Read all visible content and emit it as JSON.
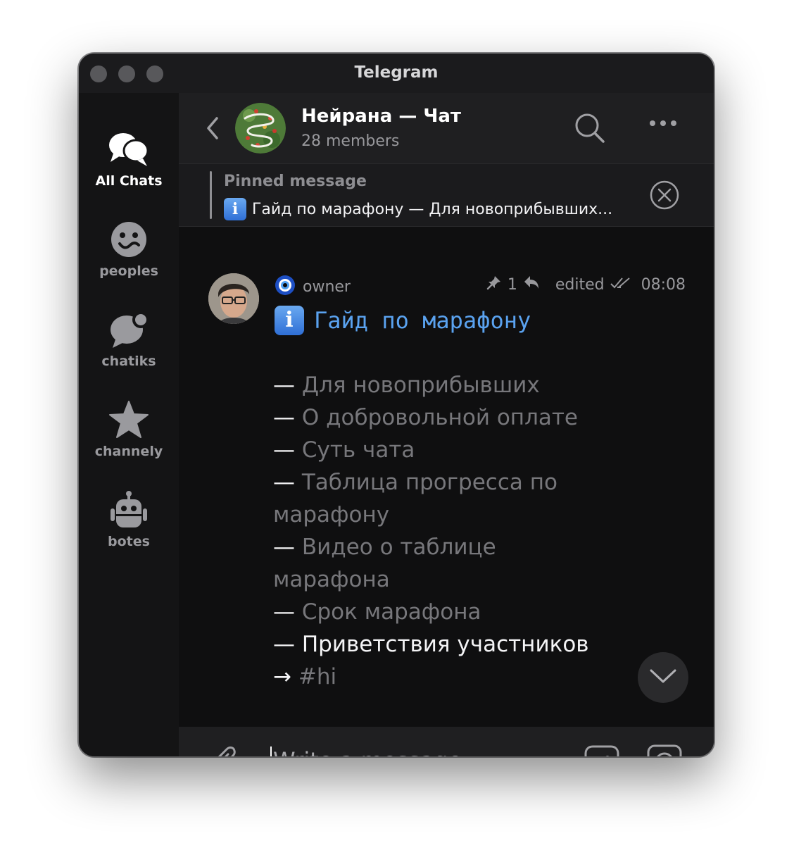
{
  "window": {
    "title": "Telegram"
  },
  "sidebar": {
    "folders": [
      {
        "label": "All Chats",
        "icon": "chat-bubbles-icon",
        "active": true
      },
      {
        "label": "peoples",
        "icon": "face-icon",
        "active": false
      },
      {
        "label": "chatiks",
        "icon": "chat-badge-icon",
        "active": false
      },
      {
        "label": "channely",
        "icon": "star-icon",
        "active": false
      },
      {
        "label": "botes",
        "icon": "robot-icon",
        "active": false
      }
    ]
  },
  "header": {
    "title": "Нейрана — Чат",
    "subtitle": "28 members",
    "icons": [
      "back-icon",
      "search-icon",
      "more-icon"
    ]
  },
  "pinned": {
    "label": "Pinned message",
    "text": "Гайд по марафону  — Для новоприбывших..."
  },
  "message": {
    "sender": "owner",
    "pin_count": "1",
    "edited": "edited",
    "time": "08:08",
    "heading": "Гайд по марафону",
    "lines": [
      {
        "dash": "— ",
        "text": "Для новоприбывших",
        "bright": false
      },
      {
        "dash": "— ",
        "text": "О добровольной оплате",
        "bright": false
      },
      {
        "dash": "— ",
        "text": "Суть чата",
        "bright": false
      },
      {
        "dash": "— ",
        "text": "Таблица прогресса по",
        "bright": false
      },
      {
        "dash": "",
        "text": "марафону",
        "bright": false
      },
      {
        "dash": "— ",
        "text": "Видео о таблице",
        "bright": false
      },
      {
        "dash": "",
        "text": "марафона",
        "bright": false
      },
      {
        "dash": "— ",
        "text": "Срок марафона",
        "bright": false
      },
      {
        "dash": "— ",
        "text": "Приветствия участников",
        "bright": true
      },
      {
        "dash": "→ ",
        "text": "#hi",
        "bright": false
      }
    ]
  },
  "composer": {
    "placeholder": "Write a message...",
    "value": ""
  },
  "colors": {
    "accent_link": "#5aa2ef",
    "background": "#0f0f10",
    "sidebar": "#141415"
  }
}
